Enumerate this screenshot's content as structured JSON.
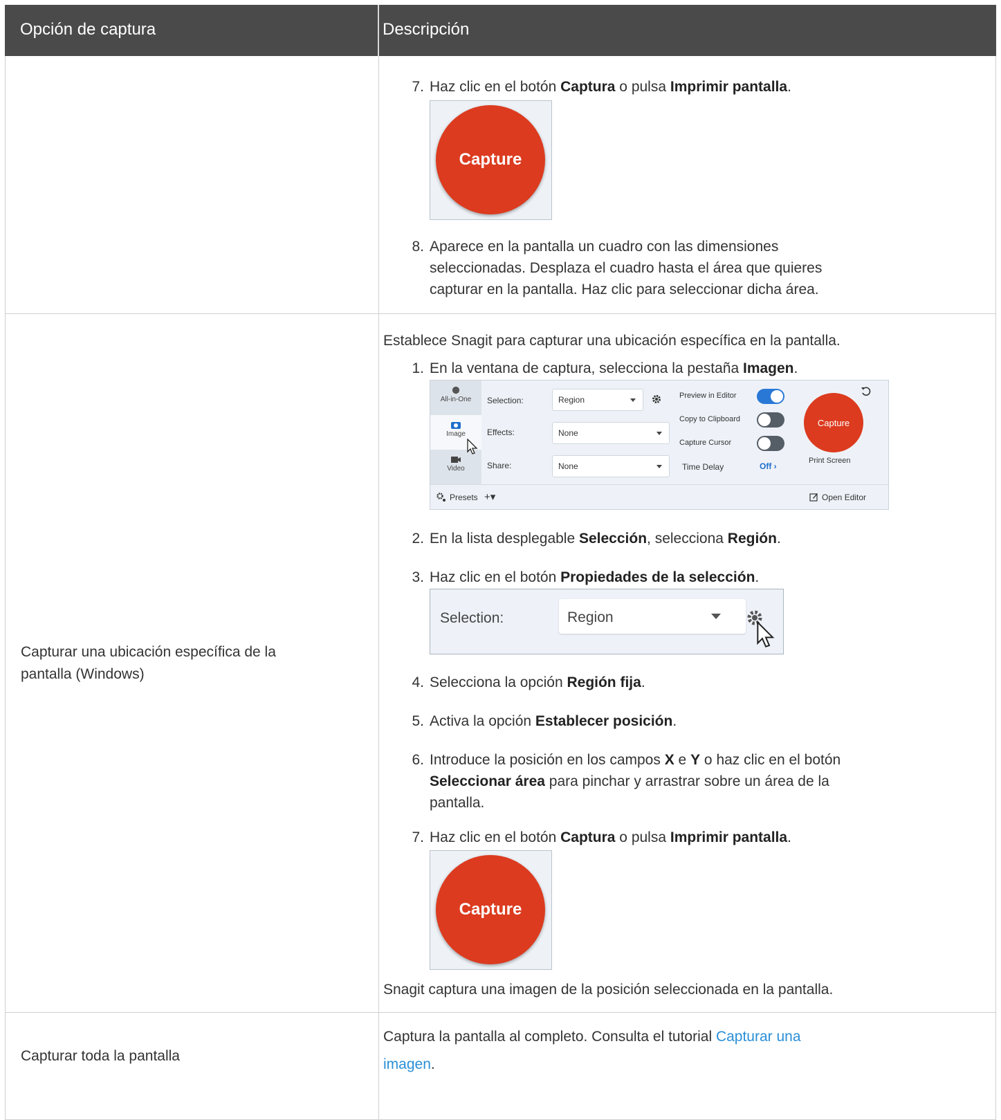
{
  "header": {
    "col1": "Opción de captura",
    "col2": "Descripción"
  },
  "row1": {
    "step7": {
      "num": "7.",
      "a": "Haz clic en el botón ",
      "b1": "Captura",
      "c": " o pulsa ",
      "b2": "Imprimir pantalla",
      "d": "."
    },
    "capture_label": "Capture",
    "step8": {
      "num": "8.",
      "l1": "Aparece en la pantalla un cuadro con las dimensiones",
      "l2": "seleccionadas. Desplaza el cuadro hasta el área que quieres",
      "l3": "capturar en la pantalla. Haz clic para seleccionar dicha área."
    }
  },
  "row2": {
    "label_l1": "Capturar una ubicación específica de la",
    "label_l2": "pantalla (Windows)",
    "intro": "Establece Snagit para capturar una ubicación específica en la pantalla.",
    "step1": {
      "num": "1.",
      "a": "En la ventana de captura, selecciona la pestaña ",
      "b": "Imagen",
      "c": "."
    },
    "panel": {
      "tabs": [
        "All-in-One",
        "Image",
        "Video"
      ],
      "selection_label": "Selection:",
      "selection_value": "Region",
      "effects_label": "Effects:",
      "effects_value": "None",
      "share_label": "Share:",
      "share_value": "None",
      "preview": "Preview in Editor",
      "clipboard": "Copy to Clipboard",
      "cursor": "Capture Cursor",
      "delay": "Time Delay",
      "delay_value": "Off",
      "capture": "Capture",
      "print_screen": "Print Screen",
      "presets": "Presets",
      "open_editor": "Open Editor",
      "toggles": {
        "preview": true,
        "clipboard": false,
        "cursor": false
      }
    },
    "step2": {
      "num": "2.",
      "a": "En la lista desplegable ",
      "b1": "Selección",
      "c": ", selecciona ",
      "b2": "Región",
      "d": "."
    },
    "step3": {
      "num": "3.",
      "a": "Haz clic en el botón ",
      "b": "Propiedades de la selección",
      "c": "."
    },
    "selbox": {
      "label": "Selection:",
      "value": "Region"
    },
    "step4": {
      "num": "4.",
      "a": "Selecciona la opción ",
      "b": "Región fija",
      "c": "."
    },
    "step5": {
      "num": "5.",
      "a": "Activa la opción ",
      "b": "Establecer posición",
      "c": "."
    },
    "step6": {
      "num": "6.",
      "a": "Introduce la posición en los campos ",
      "b1": "X",
      "c": " e ",
      "b2": "Y",
      "d": " o haz clic en el botón",
      "b3": "Seleccionar área",
      "e": " para pinchar y arrastrar sobre un área de la",
      "f": "pantalla."
    },
    "step7": {
      "num": "7.",
      "a": "Haz clic en el botón ",
      "b1": "Captura",
      "c": " o pulsa ",
      "b2": "Imprimir pantalla",
      "d": "."
    },
    "capture_label": "Capture",
    "outro": "Snagit captura una imagen de la posición seleccionada en la pantalla."
  },
  "row3": {
    "label": "Capturar toda la pantalla",
    "text": "Captura la pantalla al completo. Consulta el tutorial ",
    "link_l1": "Capturar una",
    "link_l2": "imagen",
    "end": "."
  }
}
